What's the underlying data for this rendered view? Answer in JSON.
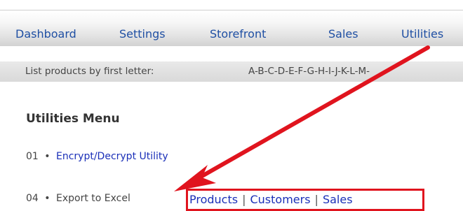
{
  "nav": {
    "items": [
      {
        "label": "Dashboard"
      },
      {
        "label": "Settings"
      },
      {
        "label": "Storefront"
      },
      {
        "label": "Sales"
      },
      {
        "label": "Utilities"
      }
    ]
  },
  "letterbar": {
    "prefix": "List products by first letter:",
    "letters": [
      "A",
      "B",
      "C",
      "D",
      "E",
      "F",
      "G",
      "H",
      "I",
      "J",
      "K",
      "L",
      "M"
    ],
    "separator": "-"
  },
  "utilities_menu": {
    "title": "Utilities Menu",
    "rows": [
      {
        "number": "01",
        "bullet": "•",
        "label": "Encrypt/Decrypt Utility"
      },
      {
        "number": "04",
        "bullet": "•",
        "label": "Export to Excel"
      }
    ],
    "export_links": [
      {
        "label": "Products"
      },
      {
        "label": "Customers"
      },
      {
        "label": "Sales"
      }
    ],
    "link_separator": "|"
  },
  "annotation": {
    "arrow_color": "#e0141e",
    "box_color": "#e0141e"
  }
}
